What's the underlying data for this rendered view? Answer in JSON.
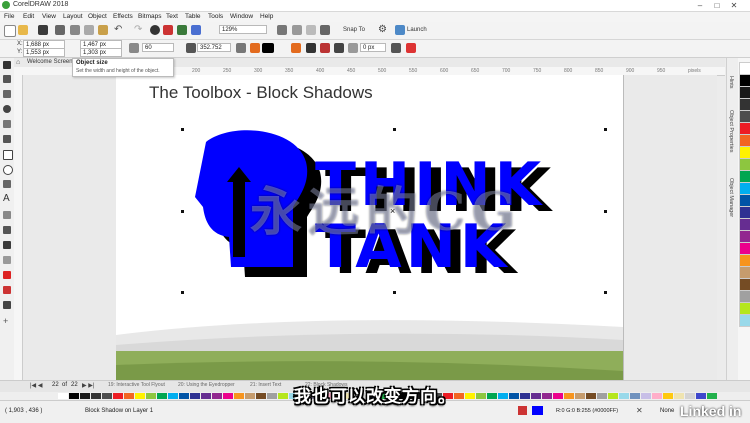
{
  "app": {
    "title": "CorelDRAW 2018"
  },
  "menus": [
    "File",
    "Edit",
    "View",
    "Layout",
    "Object",
    "Effects",
    "Bitmaps",
    "Text",
    "Table",
    "Tools",
    "Window",
    "Help"
  ],
  "toolbar": {
    "zoom": "129%",
    "snap_to": "Snap To",
    "launch": "Launch"
  },
  "propbar": {
    "x": "1,688 px",
    "y": "1,553 px",
    "w": "1,467 px",
    "h": "1,303 px",
    "lock_value": "60",
    "angle": "352.752",
    "depth": "0 px"
  },
  "tabs": {
    "welcome": "Welcome Screen"
  },
  "tooltip": {
    "title": "Object size",
    "body": "Set the width and height of the object."
  },
  "ruler_h": [
    "100",
    "150",
    "200",
    "250",
    "300",
    "350",
    "400",
    "450",
    "500",
    "550",
    "600",
    "650",
    "700",
    "750",
    "800",
    "850",
    "900",
    "950",
    "pixels"
  ],
  "slide": {
    "title": "The Toolbox - Block Shadows",
    "word1": "THINK",
    "word2": "TANK"
  },
  "watermark": "永远的CG",
  "pagenav": {
    "page": "22",
    "of_label": "of",
    "total": "22"
  },
  "pagetabs": [
    "19: Interactive Tool Flyout",
    "20: Using the Eyedropper",
    "21: Insert Text",
    "22: Block Shadows"
  ],
  "subtitle": "我也可以改变方向。",
  "status": {
    "coords": "( 1,903 , 436 )",
    "object": "Block Shadow on Layer 1",
    "fill": "R:0 G:0 B:255 (#0000FF)",
    "outline": "None"
  },
  "docktabs": [
    "Hints",
    "Object Properties",
    "Object Manager"
  ],
  "brand": "Linked in",
  "colors": {
    "accent_blue": "#0000FF",
    "shadow": "#000000",
    "green_band": "#8fae5a"
  },
  "palette": [
    "#ffffff",
    "#000000",
    "#1a1a1a",
    "#333333",
    "#4d4d4d",
    "#ed1c24",
    "#f26522",
    "#fff200",
    "#8dc63f",
    "#00a651",
    "#00aeef",
    "#0054a6",
    "#2e3192",
    "#662d91",
    "#92278f",
    "#ec008c",
    "#f7941d",
    "#c69c6d",
    "#754c24",
    "#a0a0a0",
    "#b5e61d",
    "#99d9ea",
    "#7092be",
    "#c8bfe7",
    "#ffaec9",
    "#ffc90e",
    "#efe4b0",
    "#d4d4d4",
    "#3f48cc",
    "#22b14c"
  ]
}
